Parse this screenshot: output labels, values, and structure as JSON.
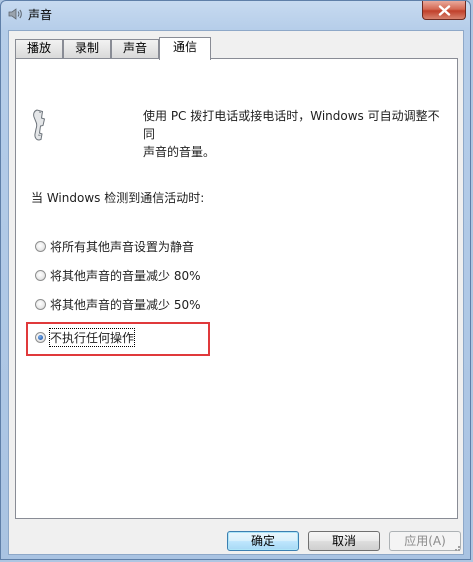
{
  "window": {
    "title": "声音",
    "close_icon": "close-icon"
  },
  "tabs": [
    {
      "label": "播放",
      "active": false
    },
    {
      "label": "录制",
      "active": false
    },
    {
      "label": "声音",
      "active": false
    },
    {
      "label": "通信",
      "active": true
    }
  ],
  "communications": {
    "icon": "phone-icon",
    "description_line1": "使用 PC 拨打电话或接电话时，Windows 可自动调整不同",
    "description_line2": "声音的音量。",
    "section_label": "当 Windows 检测到通信活动时:",
    "options": [
      {
        "label": "将所有其他声音设置为静音",
        "checked": false
      },
      {
        "label": "将其他声音的音量减少 80%",
        "checked": false
      },
      {
        "label": "将其他声音的音量减少 50%",
        "checked": false
      },
      {
        "label": "不执行任何操作",
        "checked": true
      }
    ],
    "highlight_color": "#e0393b"
  },
  "buttons": {
    "ok": "确定",
    "cancel": "取消",
    "apply": "应用(A)"
  }
}
